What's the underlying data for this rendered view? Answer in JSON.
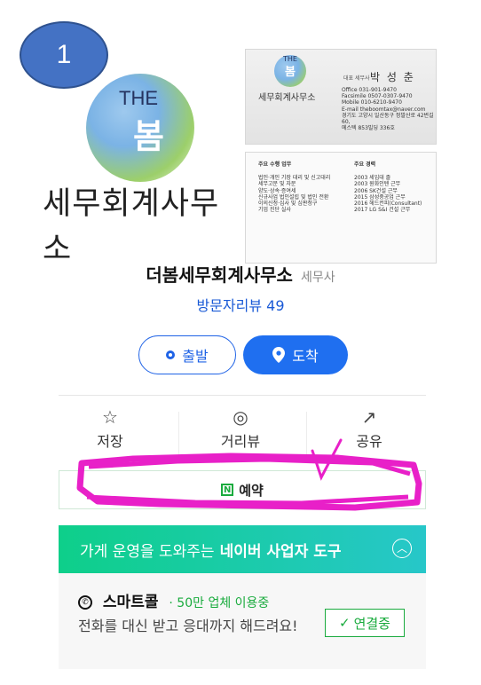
{
  "badge": "1",
  "banner": {
    "logo_the": "THE",
    "logo_bom": "봄",
    "logo_office": "세무회계사무소",
    "card_top": {
      "mini_the": "THE",
      "mini_bom": "봄",
      "office": "세무회계사무소",
      "rep_label": "대표 세무사",
      "name": "박 성 춘",
      "lines": [
        "Office 031-901-9470",
        "Facsimile 0507-0307-9470",
        "Mobile 010-6210-9470",
        "E-mail theboomtax@naver.com",
        "경기도 고양시 일산동구 정발산로 42번길 60,",
        "에스텍 853빌딩 336호"
      ]
    },
    "card_bottom": {
      "col1_head": "주요 수행 업무",
      "col1": [
        "법인·개인 기장 대리 및 신고대리",
        "세무고문 및 자문",
        "양도·상속·증여세",
        "신규사업 법인설립 및 법인 전환",
        "이의신청·심사 및 심판청구",
        "기업 진단 실사"
      ],
      "col2_head": "주요 경력",
      "col2": [
        "2003 세입대 졸",
        "2003 원화인텐 근무",
        "2006 SK건설 근무",
        "2015 삼성중공업 근무",
        "2016 헤드컨피(Consultant)",
        "2017 LG S&I 건설 근무"
      ]
    }
  },
  "place": {
    "name": "더봄세무회계사무소",
    "category": "세무사",
    "review": "방문자리뷰 49"
  },
  "buttons": {
    "depart": "출발",
    "arrive": "도착"
  },
  "actions": [
    {
      "icon": "☆",
      "label": "저장"
    },
    {
      "icon": "◎",
      "label": "거리뷰"
    },
    {
      "icon": "↗",
      "label": "공유"
    }
  ],
  "reserve": {
    "icon": "N",
    "label": "예약"
  },
  "tools": {
    "prefix": "가게 운영을 도와주는",
    "bold": "네이버 사업자 도구",
    "chevron": "︿"
  },
  "smartcall": {
    "icon": "✆",
    "title": "스마트콜",
    "sub": "· 50만 업체 이용중",
    "desc": "전화를 대신 받고 응대까지 해드려요!",
    "connect_check": "✓",
    "connect": "연결중"
  },
  "colors": {
    "accent_blue": "#1f6ff0",
    "naver_green": "#1aab3e",
    "highlight_magenta": "#e820c8",
    "badge_blue": "#4472c4"
  }
}
